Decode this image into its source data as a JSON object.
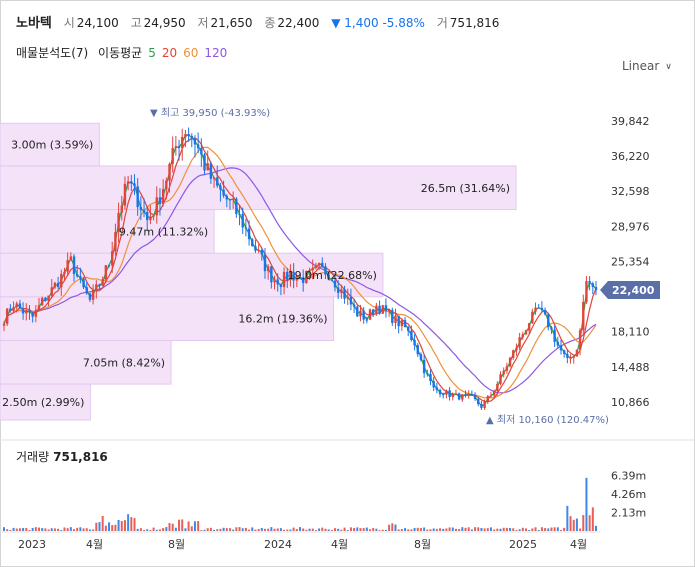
{
  "header": {
    "name": "노바텍",
    "open_label": "시",
    "open": "24,100",
    "high_label": "고",
    "high": "24,950",
    "low_label": "저",
    "low": "21,650",
    "close_label": "종",
    "close": "22,400",
    "change_arrow": "▼",
    "change": "1,400",
    "change_pct": "-5.88%",
    "volume_label": "거",
    "volume": "751,816"
  },
  "subhead": {
    "profile_label": "매물분석도(7)",
    "ma_label": "이동평균",
    "ma_periods": [
      "5",
      "20",
      "60",
      "120"
    ]
  },
  "scale_button": "Linear",
  "volume_panel": {
    "title": "거래량",
    "value": "751,816"
  },
  "colors": {
    "up": "#e0443a",
    "down": "#1a73e8",
    "profile": "#f4e2f9",
    "ma5": "#2e9c4a",
    "ma20": "#e0443a",
    "ma60": "#f0913a",
    "ma120": "#8e57e6",
    "price_tag": "#5a6fa8"
  },
  "chart_data": {
    "type": "candlestick",
    "x_ticks": [
      "2023",
      "4월",
      "8월",
      "2024",
      "4월",
      "8월",
      "2025",
      "4월"
    ],
    "y_ticks": [
      39842,
      36220,
      32598,
      28976,
      25354,
      21732,
      18110,
      14488,
      10866
    ],
    "y_tick_labels": [
      "39,842",
      "36,220",
      "32,598",
      "28,976",
      "25,354",
      "",
      "18,110",
      "14,488",
      "10,866"
    ],
    "ylim": [
      9000,
      42000
    ],
    "current_price": 22400,
    "current_price_label": "22,400",
    "max_marker": {
      "label": "최고",
      "value": "39,950 (-43.93%)",
      "price": 39950
    },
    "min_marker": {
      "label": "최저",
      "value": "10,160 (120.47%)",
      "price": 10160
    },
    "volume_profile": [
      {
        "label": "3.00m (3.59%)",
        "low": 35200,
        "high": 39600,
        "share": 3.59
      },
      {
        "label": "26.5m (31.64%)",
        "low": 30700,
        "high": 35200,
        "share": 31.64
      },
      {
        "label": "9.47m (11.32%)",
        "low": 26200,
        "high": 30700,
        "share": 11.32
      },
      {
        "label": "19.0m (22.68%)",
        "low": 21700,
        "high": 26200,
        "share": 22.68
      },
      {
        "label": "16.2m (19.36%)",
        "low": 17200,
        "high": 21700,
        "share": 19.36
      },
      {
        "label": "7.05m (8.42%)",
        "low": 12700,
        "high": 17200,
        "share": 8.42
      },
      {
        "label": "2.50m (2.99%)",
        "low": 9000,
        "high": 12700,
        "share": 2.99
      }
    ],
    "price_path": [
      [
        0,
        19500
      ],
      [
        3,
        21000
      ],
      [
        6,
        20200
      ],
      [
        9,
        19600
      ],
      [
        12,
        21200
      ],
      [
        15,
        22400
      ],
      [
        18,
        23800
      ],
      [
        21,
        25400
      ],
      [
        24,
        23000
      ],
      [
        27,
        21300
      ],
      [
        30,
        23000
      ],
      [
        33,
        25200
      ],
      [
        36,
        30500
      ],
      [
        39,
        33500
      ],
      [
        42,
        31800
      ],
      [
        45,
        29600
      ],
      [
        48,
        31200
      ],
      [
        51,
        34000
      ],
      [
        54,
        37200
      ],
      [
        57,
        39000
      ],
      [
        60,
        37800
      ],
      [
        63,
        35300
      ],
      [
        66,
        33300
      ],
      [
        69,
        32100
      ],
      [
        72,
        31000
      ],
      [
        75,
        29300
      ],
      [
        78,
        27200
      ],
      [
        81,
        25500
      ],
      [
        84,
        23800
      ],
      [
        87,
        23300
      ],
      [
        90,
        24100
      ],
      [
        93,
        23500
      ],
      [
        96,
        23900
      ],
      [
        99,
        24600
      ],
      [
        102,
        24200
      ],
      [
        105,
        22800
      ],
      [
        108,
        21400
      ],
      [
        111,
        20000
      ],
      [
        114,
        19500
      ],
      [
        117,
        20800
      ],
      [
        120,
        20100
      ],
      [
        123,
        19300
      ],
      [
        126,
        18500
      ],
      [
        129,
        17000
      ],
      [
        132,
        14200
      ],
      [
        135,
        12200
      ],
      [
        138,
        11900
      ],
      [
        141,
        11500
      ],
      [
        144,
        11400
      ],
      [
        147,
        11300
      ],
      [
        150,
        10400
      ],
      [
        153,
        11600
      ],
      [
        156,
        13400
      ],
      [
        159,
        15300
      ],
      [
        162,
        17300
      ],
      [
        165,
        19200
      ],
      [
        168,
        20400
      ],
      [
        171,
        18900
      ],
      [
        174,
        16700
      ],
      [
        177,
        15000
      ],
      [
        180,
        16300
      ],
      [
        183,
        23300
      ],
      [
        186,
        22400
      ]
    ],
    "x_max": 186,
    "volume_axis_ticks": [
      "6.39m",
      "4.26m",
      "2.13m"
    ],
    "volume_axis_values": [
      6.39,
      4.26,
      2.13
    ],
    "volume_max": 7.0
  }
}
